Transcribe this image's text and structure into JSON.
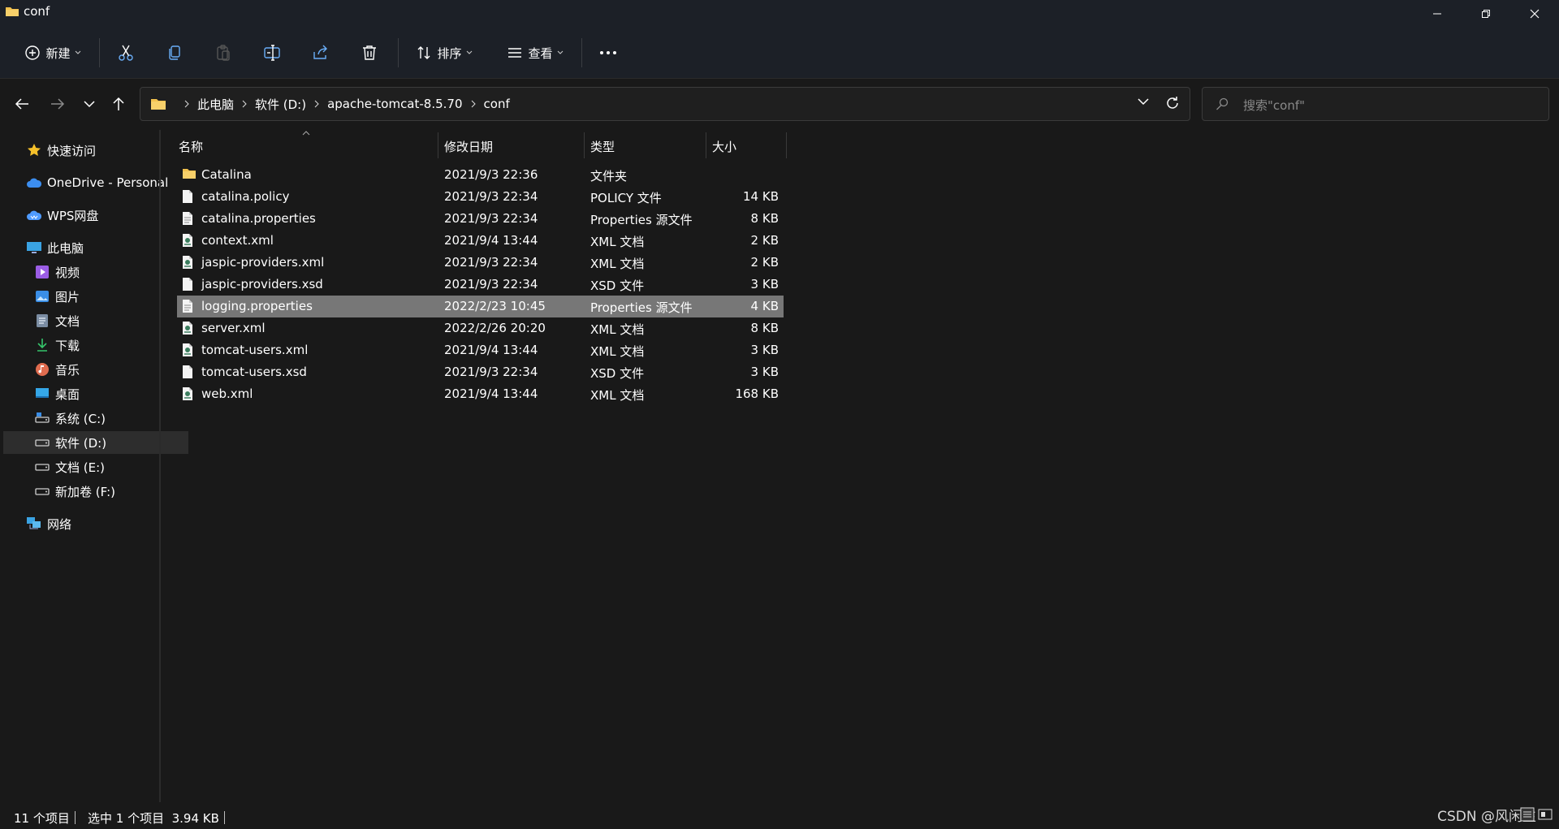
{
  "window": {
    "title": "conf"
  },
  "toolbar": {
    "new_label": "新建",
    "sort_label": "排序",
    "view_label": "查看"
  },
  "address": {
    "crumbs": [
      "此电脑",
      "软件 (D:)",
      "apache-tomcat-8.5.70",
      "conf"
    ]
  },
  "search": {
    "placeholder": "搜索\"conf\""
  },
  "sidebar": {
    "items": [
      {
        "label": "快速访问",
        "icon": "star-icon"
      },
      {
        "label": "OneDrive - Personal",
        "icon": "onedrive-cloud-icon"
      },
      {
        "label": "WPS网盘",
        "icon": "wps-cloud-icon"
      },
      {
        "label": "此电脑",
        "icon": "computer-icon"
      },
      {
        "label": "视频",
        "icon": "video-icon"
      },
      {
        "label": "图片",
        "icon": "pictures-icon"
      },
      {
        "label": "文档",
        "icon": "documents-icon"
      },
      {
        "label": "下载",
        "icon": "download-icon"
      },
      {
        "label": "音乐",
        "icon": "music-icon"
      },
      {
        "label": "桌面",
        "icon": "desktop-icon"
      },
      {
        "label": "系统 (C:)",
        "icon": "system-drive-icon"
      },
      {
        "label": "软件 (D:)",
        "icon": "drive-icon"
      },
      {
        "label": "文档 (E:)",
        "icon": "drive-icon"
      },
      {
        "label": "新加卷 (F:)",
        "icon": "drive-icon"
      },
      {
        "label": "网络",
        "icon": "network-icon"
      }
    ],
    "selected": "软件 (D:)"
  },
  "columns": {
    "name": "名称",
    "date": "修改日期",
    "type": "类型",
    "size": "大小"
  },
  "files": [
    {
      "name": "Catalina",
      "date": "2021/9/3 22:36",
      "type": "文件夹",
      "size": "",
      "icon": "folder-icon"
    },
    {
      "name": "catalina.policy",
      "date": "2021/9/3 22:34",
      "type": "POLICY 文件",
      "size": "14 KB",
      "icon": "file-icon"
    },
    {
      "name": "catalina.properties",
      "date": "2021/9/3 22:34",
      "type": "Properties 源文件",
      "size": "8 KB",
      "icon": "text-file-icon"
    },
    {
      "name": "context.xml",
      "date": "2021/9/4 13:44",
      "type": "XML 文档",
      "size": "2 KB",
      "icon": "xml-file-icon"
    },
    {
      "name": "jaspic-providers.xml",
      "date": "2021/9/3 22:34",
      "type": "XML 文档",
      "size": "2 KB",
      "icon": "xml-file-icon"
    },
    {
      "name": "jaspic-providers.xsd",
      "date": "2021/9/3 22:34",
      "type": "XSD 文件",
      "size": "3 KB",
      "icon": "file-icon"
    },
    {
      "name": "logging.properties",
      "date": "2022/2/23 10:45",
      "type": "Properties 源文件",
      "size": "4 KB",
      "icon": "text-file-icon"
    },
    {
      "name": "server.xml",
      "date": "2022/2/26 20:20",
      "type": "XML 文档",
      "size": "8 KB",
      "icon": "xml-file-icon"
    },
    {
      "name": "tomcat-users.xml",
      "date": "2021/9/4 13:44",
      "type": "XML 文档",
      "size": "3 KB",
      "icon": "xml-file-icon"
    },
    {
      "name": "tomcat-users.xsd",
      "date": "2021/9/3 22:34",
      "type": "XSD 文件",
      "size": "3 KB",
      "icon": "file-icon"
    },
    {
      "name": "web.xml",
      "date": "2021/9/4 13:44",
      "type": "XML 文档",
      "size": "168 KB",
      "icon": "xml-file-icon"
    }
  ],
  "selected_file": "logging.properties",
  "status": {
    "item_count": "11 个项目",
    "selection": "选中 1 个项目  3.94 KB"
  },
  "watermark": "CSDN @风闲生",
  "colors": {
    "background": "#191919",
    "chrome": "#1c2027",
    "selected_row": "#777777",
    "folder": "#f2c14e",
    "accent_blue": "#4aa8ff"
  }
}
